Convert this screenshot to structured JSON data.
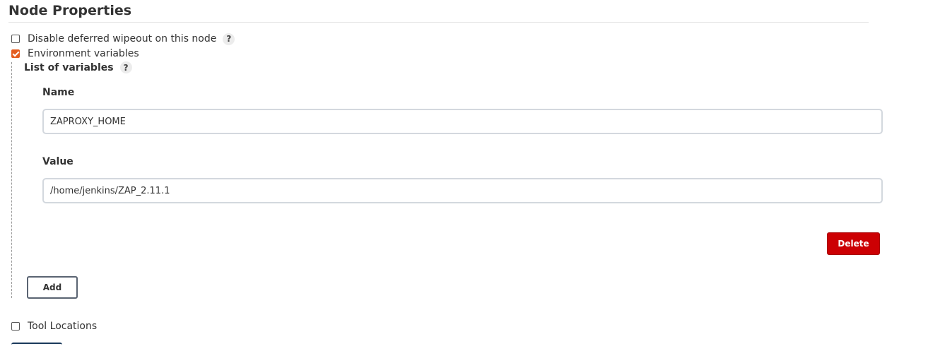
{
  "section": {
    "title": "Node Properties"
  },
  "options": {
    "disable_wipeout": {
      "label": "Disable deferred wipeout on this node",
      "checked": false,
      "help": "?"
    },
    "env_vars": {
      "label": "Environment variables",
      "checked": true
    },
    "tool_locations": {
      "label": "Tool Locations",
      "checked": false
    }
  },
  "env": {
    "list_label": "List of variables",
    "list_help": "?",
    "name_label": "Name",
    "name_value": "ZAPROXY_HOME",
    "value_label": "Value",
    "value_value": "/home/jenkins/ZAP_2.11.1",
    "delete_label": "Delete",
    "add_label": "Add"
  },
  "colors": {
    "checkbox_accent": "#e45d1f",
    "delete_button": "#cc0003"
  }
}
